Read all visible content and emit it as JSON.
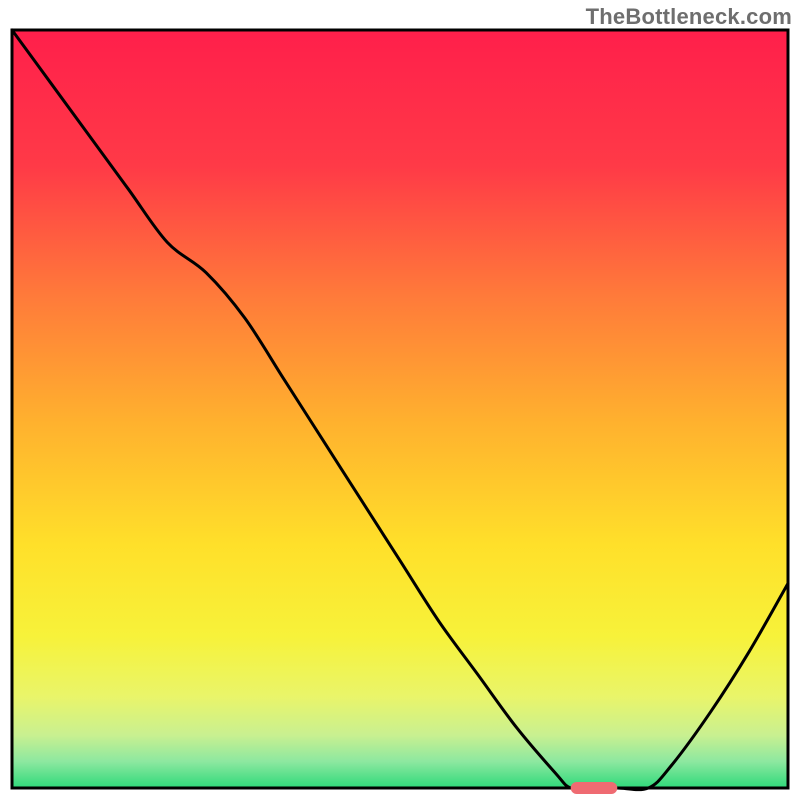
{
  "watermark": "TheBottleneck.com",
  "chart_data": {
    "type": "line",
    "title": "",
    "xlabel": "",
    "ylabel": "",
    "xlim": [
      0,
      100
    ],
    "ylim": [
      0,
      100
    ],
    "x": [
      0,
      5,
      10,
      15,
      20,
      25,
      30,
      35,
      40,
      45,
      50,
      55,
      60,
      65,
      70,
      72,
      75,
      78,
      82,
      85,
      90,
      95,
      100
    ],
    "values": [
      100,
      93,
      86,
      79,
      72,
      68,
      62,
      54,
      46,
      38,
      30,
      22,
      15,
      8,
      2,
      0,
      0,
      0,
      0,
      3,
      10,
      18,
      27
    ],
    "marker": {
      "x_start": 72,
      "x_end": 78,
      "y": 0
    },
    "gradient_stops": [
      {
        "pos": 0.0,
        "color": "#ff1f4b"
      },
      {
        "pos": 0.18,
        "color": "#ff3a47"
      },
      {
        "pos": 0.35,
        "color": "#ff7a3a"
      },
      {
        "pos": 0.52,
        "color": "#ffb22e"
      },
      {
        "pos": 0.68,
        "color": "#ffe02a"
      },
      {
        "pos": 0.8,
        "color": "#f7f23a"
      },
      {
        "pos": 0.88,
        "color": "#e9f56a"
      },
      {
        "pos": 0.93,
        "color": "#c9f090"
      },
      {
        "pos": 0.965,
        "color": "#8de8a0"
      },
      {
        "pos": 1.0,
        "color": "#2fd97a"
      }
    ],
    "frame": {
      "stroke": "#000000",
      "stroke_width": 3,
      "inset_top": 30,
      "inset_left": 12,
      "inset_right": 12,
      "inset_bottom": 12
    },
    "line_style": {
      "stroke": "#000000",
      "stroke_width": 3
    },
    "marker_style": {
      "fill": "#ef6b72",
      "rx": 6,
      "height": 12
    }
  }
}
